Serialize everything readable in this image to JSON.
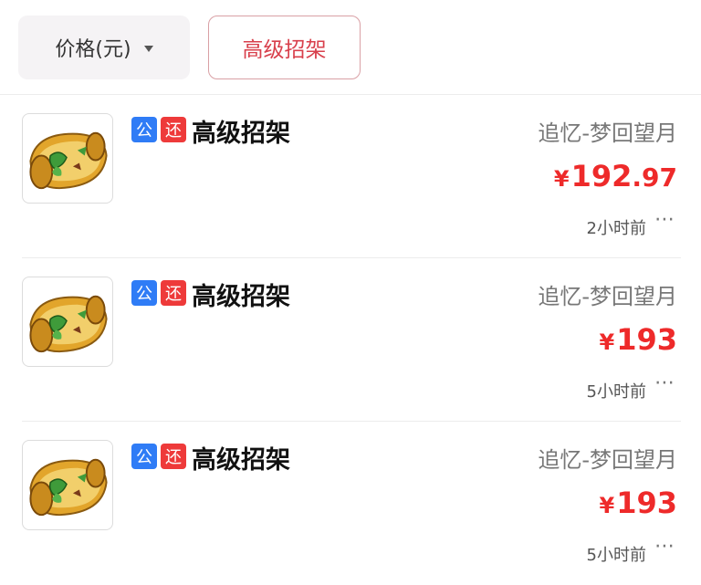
{
  "topbar": {
    "sort_label": "价格(元)",
    "filter_label": "高级招架"
  },
  "colors": {
    "accent_red": "#ee2a2a",
    "tag_blue": "#2f7cf6",
    "tag_red": "#ee3a3a"
  },
  "listings": [
    {
      "tag_public": "公",
      "tag_return": "还",
      "name": "高级招架",
      "server": "追忆-梦回望月",
      "currency": "¥",
      "price_int": "192",
      "price_dec": ".97",
      "time": "2小时前",
      "more": "⋯",
      "icon": "skill-scroll-icon"
    },
    {
      "tag_public": "公",
      "tag_return": "还",
      "name": "高级招架",
      "server": "追忆-梦回望月",
      "currency": "¥",
      "price_int": "193",
      "price_dec": "",
      "time": "5小时前",
      "more": "⋯",
      "icon": "skill-scroll-icon"
    },
    {
      "tag_public": "公",
      "tag_return": "还",
      "name": "高级招架",
      "server": "追忆-梦回望月",
      "currency": "¥",
      "price_int": "193",
      "price_dec": "",
      "time": "5小时前",
      "more": "⋯",
      "icon": "skill-scroll-icon"
    }
  ]
}
